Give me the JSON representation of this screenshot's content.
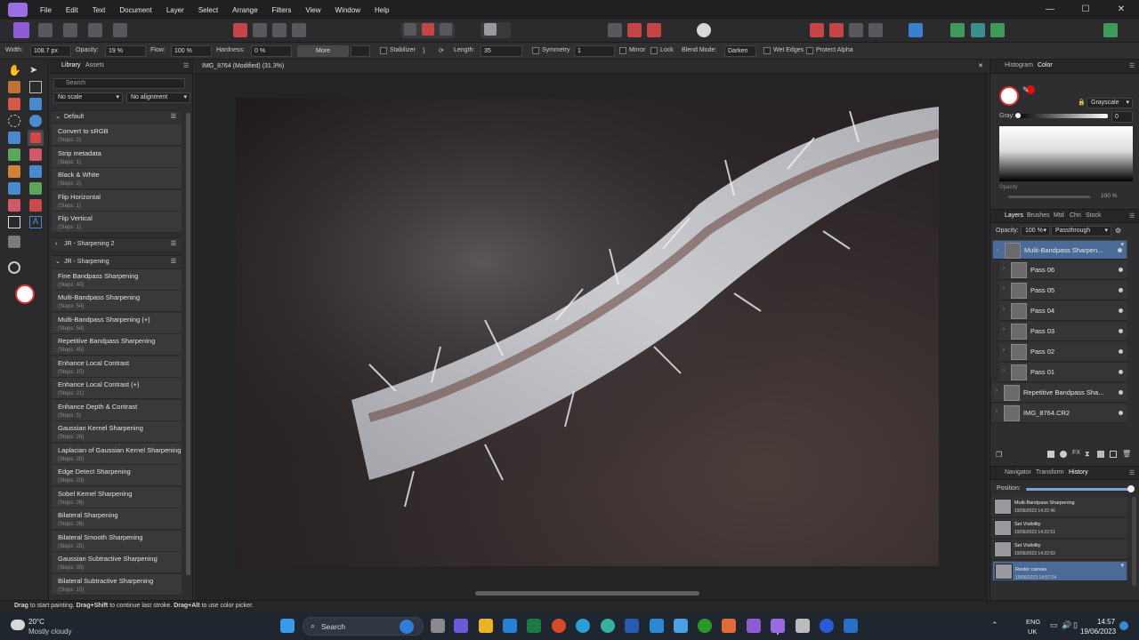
{
  "menu": {
    "items": [
      "File",
      "Edit",
      "Text",
      "Document",
      "Layer",
      "Select",
      "Arrange",
      "Filters",
      "View",
      "Window",
      "Help"
    ],
    "window_controls": [
      "—",
      "☐",
      "✕"
    ]
  },
  "context": {
    "width_label": "Width:",
    "width_value": "108.7 px",
    "opacity_label": "Opacity:",
    "opacity_value": "19 %",
    "flow_label": "Flow:",
    "flow_value": "100 %",
    "hardness_label": "Hardness:",
    "hardness_value": "0 %",
    "more": "More",
    "stabilizer": "Stabilizer",
    "length_label": "Length:",
    "length_value": "35",
    "symmetry": "Symmetry",
    "symmetry_value": "1",
    "mirror": "Mirror",
    "lock": "Lock",
    "blend_label": "Blend Mode:",
    "blend_value": "Darken",
    "wet_edges": "Wet Edges",
    "protect_alpha": "Protect Alpha"
  },
  "library": {
    "tabs": [
      "Library",
      "Assets"
    ],
    "search_placeholder": "Search",
    "scale": "No scale",
    "alignment": "No alignment",
    "categories": [
      {
        "name": "Default",
        "expanded": true,
        "macros": [
          {
            "name": "Convert to sRGB",
            "steps": "(Steps: 2)"
          },
          {
            "name": "Strip metadata",
            "steps": "(Steps: 1)"
          },
          {
            "name": "Black & White",
            "steps": "(Steps: 2)"
          },
          {
            "name": "Flip Horizontal",
            "steps": "(Steps: 1)"
          },
          {
            "name": "Flip Vertical",
            "steps": "(Steps: 1)"
          }
        ]
      },
      {
        "name": "JR - Sharpening 2",
        "expanded": false,
        "macros": []
      },
      {
        "name": "JR - Sharpening",
        "expanded": true,
        "macros": [
          {
            "name": "Fine Bandpass Sharpening",
            "steps": "(Steps: 40)"
          },
          {
            "name": "Multi-Bandpass Sharpening",
            "steps": "(Steps: 54)"
          },
          {
            "name": "Multi-Bandpass Sharpening (+)",
            "steps": "(Steps: 54)"
          },
          {
            "name": "Repetitive Bandpass Sharpening",
            "steps": "(Steps: 45)"
          },
          {
            "name": "Enhance Local Contrast",
            "steps": "(Steps: 15)"
          },
          {
            "name": "Enhance Local Contrast (+)",
            "steps": "(Steps: 21)"
          },
          {
            "name": "Enhance Depth & Contrast",
            "steps": "(Steps: 5)"
          },
          {
            "name": "Gaussian Kernel Sharpening",
            "steps": "(Steps: 26)"
          },
          {
            "name": "Laplacian of Gaussian Kernel Sharpening",
            "steps": "(Steps: 25)"
          },
          {
            "name": "Edge Detect Sharpening",
            "steps": "(Steps: 23)"
          },
          {
            "name": "Sobel Kernel Sharpening",
            "steps": "(Steps: 26)"
          },
          {
            "name": "Bilateral Sharpening",
            "steps": "(Steps: 26)"
          },
          {
            "name": "Bilateral Smooth Sharpening",
            "steps": "(Steps: 25)"
          },
          {
            "name": "Gaussian Subtractive Sharpening",
            "steps": "(Steps: 35)"
          },
          {
            "name": "Bilateral Subtractive Sharpening",
            "steps": "(Steps: 10)"
          }
        ]
      }
    ]
  },
  "document": {
    "title": "IMG_8764 (Modified) (31.3%)"
  },
  "color_panel": {
    "tabs": [
      "Histogram",
      "Color"
    ],
    "mode": "Grayscale",
    "gray_label": "Gray:",
    "gray_value": "0",
    "opacity_label": "Opacity",
    "opacity_value": "100 %"
  },
  "layers_panel": {
    "tabs": [
      "Layers",
      "Brushes",
      "Mtd",
      "Chn",
      "Stock"
    ],
    "opacity_label": "Opacity:",
    "opacity_value": "100 %",
    "blend": "Passthrough",
    "layers": [
      {
        "name": "Multi-Bandpass Sharpen...",
        "selected": true,
        "child": false
      },
      {
        "name": "Pass 06",
        "child": true
      },
      {
        "name": "Pass 05",
        "child": true
      },
      {
        "name": "Pass 04",
        "child": true
      },
      {
        "name": "Pass 03",
        "child": true
      },
      {
        "name": "Pass 02",
        "child": true
      },
      {
        "name": "Pass 01",
        "child": true
      },
      {
        "name": "Repetitive Bandpass Sha...",
        "child": false
      },
      {
        "name": "IMG_8764.CR2",
        "child": false
      }
    ]
  },
  "history_panel": {
    "tabs": [
      "Navigator",
      "Transform",
      "History"
    ],
    "position_label": "Position:",
    "items": [
      {
        "name": "Multi-Bandpass Sharpening",
        "time": "19/06/2023 14:22:46"
      },
      {
        "name": "Set Visibility",
        "time": "19/06/2023 14:22:51"
      },
      {
        "name": "Set Visibility",
        "time": "19/06/2023 14:22:52"
      },
      {
        "name": "Rester canvas",
        "time": "19/06/2023 14:57:24",
        "selected": true
      }
    ]
  },
  "status": {
    "b1": "Drag",
    "t1": " to start painting. ",
    "b2": "Drag+Shift",
    "t2": " to continue last stroke. ",
    "b3": "Drag+Alt",
    "t3": " to use color picker."
  },
  "taskbar": {
    "temp": "20°C",
    "weather": "Mostly cloudy",
    "search": "Search",
    "lang1": "ENG",
    "lang2": "UK",
    "time": "14:57",
    "date": "19/06/2023"
  }
}
